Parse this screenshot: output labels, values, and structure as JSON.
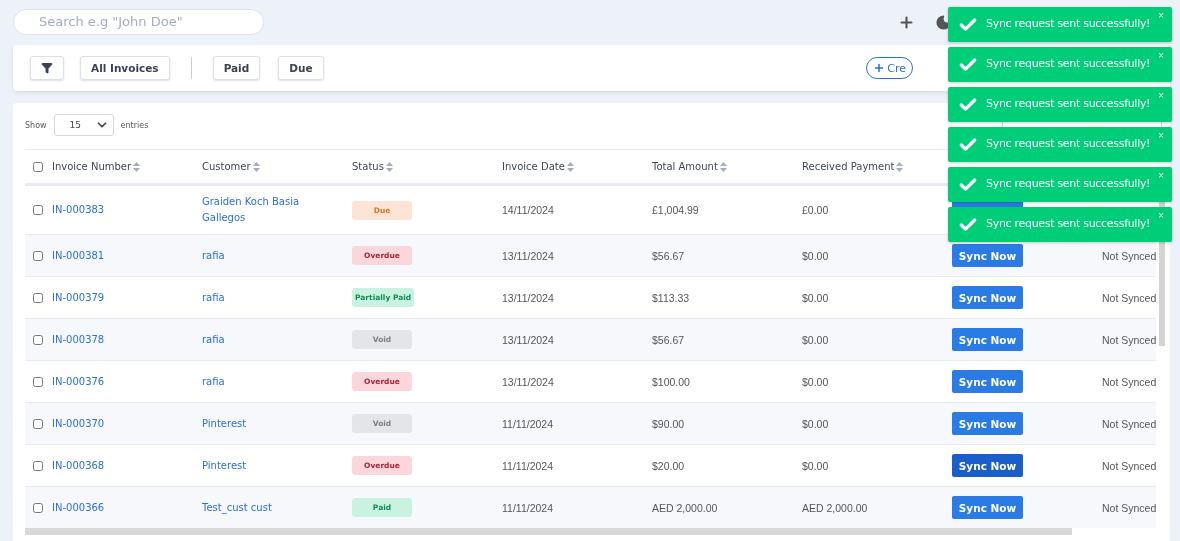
{
  "search": {
    "placeholder": "Search e.g \"John Doe\""
  },
  "filter_bar": {
    "filter_groups": [
      [
        "All Invoices"
      ],
      [
        "Paid",
        "Due"
      ]
    ],
    "create_button": "Cre"
  },
  "table_controls": {
    "show_label": "Show",
    "page_size": "15",
    "entries_label": "entries"
  },
  "table": {
    "select_all_checked": false,
    "columns": [
      {
        "label": "Invoice Number",
        "sortable": true
      },
      {
        "label": "Customer",
        "sortable": true
      },
      {
        "label": "Status",
        "sortable": true
      },
      {
        "label": "Invoice Date",
        "sortable": true
      },
      {
        "label": "Total Amount",
        "sortable": true
      },
      {
        "label": "Received Payment",
        "sortable": true
      }
    ],
    "rows": [
      {
        "checked": false,
        "invoice": "IN-000383",
        "customer": "Graiden Koch Basia Gallegos",
        "status": {
          "label": "Due",
          "kind": "due"
        },
        "date": "14/11/2024",
        "total": "£1,004.99",
        "received": "£0.00",
        "sync": {
          "highlighted": false
        }
      },
      {
        "checked": false,
        "invoice": "IN-000381",
        "customer": "rafia",
        "status": {
          "label": "Overdue",
          "kind": "overdue"
        },
        "date": "13/11/2024",
        "total": "$56.67",
        "received": "$0.00",
        "sync": {
          "label": "Sync Now",
          "highlighted": false
        },
        "sync_status": "Not Synced"
      },
      {
        "checked": false,
        "invoice": "IN-000379",
        "customer": "rafia",
        "status": {
          "label": "Partially Paid",
          "kind": "paid"
        },
        "date": "13/11/2024",
        "total": "$113.33",
        "received": "$0.00",
        "sync": {
          "label": "Sync Now",
          "highlighted": false
        },
        "sync_status": "Not Synced"
      },
      {
        "checked": false,
        "invoice": "IN-000378",
        "customer": "rafia",
        "status": {
          "label": "Void",
          "kind": "void"
        },
        "date": "13/11/2024",
        "total": "$56.67",
        "received": "$0.00",
        "sync": {
          "label": "Sync Now",
          "highlighted": false
        },
        "sync_status": "Not Synced"
      },
      {
        "checked": false,
        "invoice": "IN-000376",
        "customer": "rafia",
        "status": {
          "label": "Overdue",
          "kind": "overdue"
        },
        "date": "13/11/2024",
        "total": "$100.00",
        "received": "$0.00",
        "sync": {
          "label": "Sync Now",
          "highlighted": false
        },
        "sync_status": "Not Synced"
      },
      {
        "checked": false,
        "invoice": "IN-000370",
        "customer": "Pinterest",
        "status": {
          "label": "Void",
          "kind": "void"
        },
        "date": "11/11/2024",
        "total": "$90.00",
        "received": "$0.00",
        "sync": {
          "label": "Sync Now",
          "highlighted": false
        },
        "sync_status": "Not Synced"
      },
      {
        "checked": false,
        "invoice": "IN-000368",
        "customer": "Pinterest",
        "status": {
          "label": "Overdue",
          "kind": "overdue"
        },
        "date": "11/11/2024",
        "total": "$20.00",
        "received": "$0.00",
        "sync": {
          "label": "Sync Now",
          "highlighted": true
        },
        "sync_status": "Not Synced"
      },
      {
        "checked": false,
        "invoice": "IN-000366",
        "customer": "Test_cust cust",
        "status": {
          "label": "Paid",
          "kind": "paid"
        },
        "date": "11/11/2024",
        "total": "AED 2,000.00",
        "received": "AED 2,000.00",
        "sync": {
          "label": "Sync Now",
          "highlighted": false
        },
        "sync_status": "Not Synced"
      }
    ]
  },
  "toasts": [
    {
      "message": "Sync request sent successfully!",
      "close": "×"
    },
    {
      "message": "Sync request sent successfully!",
      "close": "×"
    },
    {
      "message": "Sync request sent successfully!",
      "close": "×"
    },
    {
      "message": "Sync request sent successfully!",
      "close": "×"
    },
    {
      "message": "Sync request sent successfully!",
      "close": "×"
    },
    {
      "message": "Sync request sent successfully!",
      "close": "×"
    }
  ]
}
